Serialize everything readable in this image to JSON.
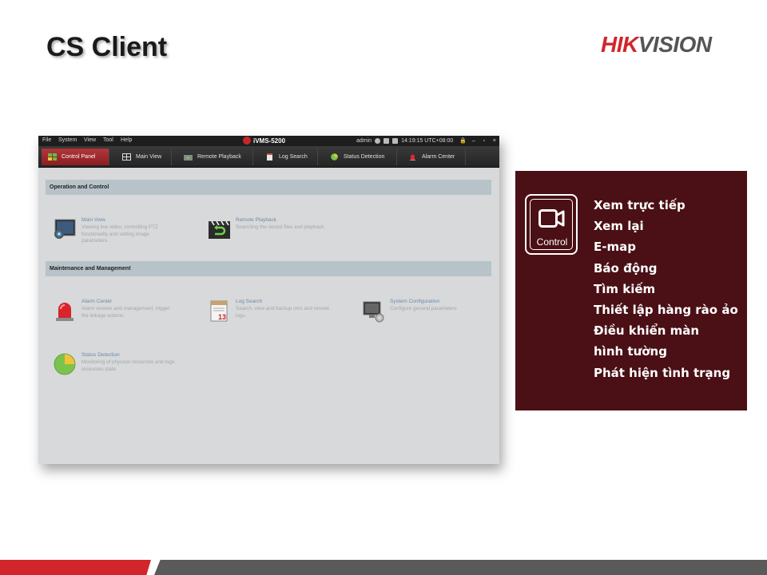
{
  "slide": {
    "title": "CS Client"
  },
  "brand": {
    "part1": "HIK",
    "part2": "VISION"
  },
  "app": {
    "menu": [
      "File",
      "System",
      "View",
      "Tool",
      "Help"
    ],
    "name": "iVMS-5200",
    "user": "admin",
    "time": "14:19:15 UTC+08:00",
    "window_controls": {
      "lock": "🔒",
      "minimize": "–",
      "maximize": "▫",
      "close": "×"
    },
    "tabs": [
      {
        "label": "Control Panel",
        "icon": "control-panel-icon",
        "active": true
      },
      {
        "label": "Main View",
        "icon": "main-view-icon",
        "active": false
      },
      {
        "label": "Remote Playback",
        "icon": "remote-playback-icon",
        "active": false
      },
      {
        "label": "Log Search",
        "icon": "log-search-icon",
        "active": false
      },
      {
        "label": "Status Detection",
        "icon": "status-detection-icon",
        "active": false
      },
      {
        "label": "Alarm Center",
        "icon": "alarm-center-icon",
        "active": false
      }
    ],
    "sections": [
      {
        "title": "Operation and Control",
        "modules": [
          {
            "title": "Main View",
            "desc": "Viewing live video, controlling PTZ functionality and setting image parameters.",
            "icon": "camera-icon"
          },
          {
            "title": "Remote Playback",
            "desc": "Searching the record files and playback.",
            "icon": "clapperboard-icon"
          }
        ]
      },
      {
        "title": "Maintenance and Management",
        "modules": [
          {
            "title": "Alarm Center",
            "desc": "Alarm receive and management, trigger the linkage actions.",
            "icon": "siren-icon"
          },
          {
            "title": "Log Search",
            "desc": "Search, view and backup cms and remote logs.",
            "icon": "calendar-icon",
            "icon_text": "13"
          },
          {
            "title": "System Configuration",
            "desc": "Configure general parameters",
            "icon": "monitor-gear-icon"
          },
          {
            "title": "Status Detection",
            "desc": "Monitoring of physical resources and logic resources state.",
            "icon": "pie-chart-icon"
          }
        ]
      }
    ]
  },
  "panel": {
    "icon_label": "Control",
    "icon": "camera-outline-icon",
    "features": [
      "Xem trực tiếp",
      "Xem lại",
      "E-map",
      "Báo động",
      "Tìm kiếm",
      "Thiết lập hàng rào ảo",
      "Điều khiển màn",
      "hình tường",
      "Phát hiện tình trạng"
    ]
  },
  "colors": {
    "brand_red": "#d1262b",
    "panel_bg": "#4a1015",
    "tab_active": "#a52a2e",
    "section_header": "#b7c3c8",
    "link_blue": "#6c8ba9"
  }
}
